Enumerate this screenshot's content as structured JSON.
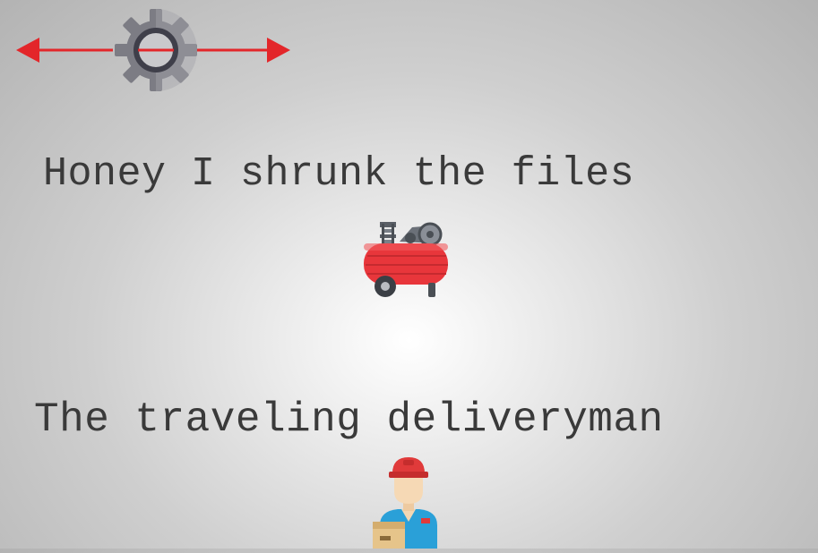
{
  "logo": {
    "icon": "gear-with-double-arrow-icon",
    "gear_color": "#7c7c84",
    "arrow_color": "#e3262a"
  },
  "sections": [
    {
      "title": "Honey I shrunk the files",
      "icon": "air-compressor-icon"
    },
    {
      "title": "The traveling deliveryman",
      "icon": "delivery-man-icon"
    }
  ],
  "colors": {
    "text": "#3a3a3a",
    "compressor_red": "#e8363b",
    "helmet_red": "#e03a3a",
    "uniform_blue": "#2aa0d8"
  }
}
